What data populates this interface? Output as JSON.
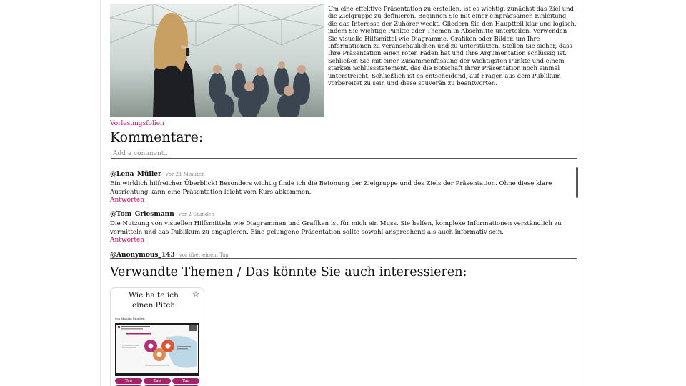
{
  "article": {
    "description": "Um eine effektive Präsentation zu erstellen, ist es wichtig, zunächst das Ziel und die Zielgruppe zu definieren. Beginnen Sie mit einer einprägsamen Einleitung, die das Interesse der Zuhörer weckt. Gliedern Sie den Hauptteil klar und logisch, indem Sie wichtige Punkte oder Themen in Abschnitte unterteilen. Verwenden Sie visuelle Hilfsmittel wie Diagramme, Grafiken oder Bilder, um Ihre Informationen zu veranschaulichen und zu unterstützen. Stellen Sie sicher, dass Ihre Präsentation einen roten Faden hat und Ihre Argumentation schlüssig ist. Schließen Sie mit einer Zusammenfassung der wichtigsten Punkte und einem starken Schlussstatement, das die Botschaft Ihrer Präsentation noch einmal unterstreicht. Schließlich ist es entscheidend, auf Fragen aus dem Publikum vorbereitet zu sein und diese souverän zu beantworten.",
    "image_caption": "Vorlesungsfolien"
  },
  "comments": {
    "title": "Kommentare:",
    "input_placeholder": "Add a comment...",
    "items": [
      {
        "user": "@Lena_Müller",
        "time": "vor 21 Minuten",
        "text": "Ein wirklich hilfreicher Überblick! Besonders wichtig finde ich die Betonung der Zielgruppe und des Ziels der Präsentation. Ohne diese klare Ausrichtung kann eine Präsentation leicht vom Kurs abkommen.",
        "reply": "Antworten"
      },
      {
        "user": "@Tom_Griesmann",
        "time": "vor 2 Stunden",
        "text": "Die Nutzung von visuellen Hilfsmitteln wie Diagrammen und Grafiken ist für mich ein Muss. Sie helfen, komplexe Informationen verständlich zu vermitteln und das Publikum zu engagieren. Eine gelungene Präsentation sollte sowohl ansprechend als auch informativ sein.",
        "reply": "Antworten"
      },
      {
        "user": "@Anonymous_143",
        "time": "vor über einem Tag"
      }
    ]
  },
  "related": {
    "title": "Verwandte Themen / Das könnte Sie auch interessieren:",
    "cards": [
      {
        "title": "Wie halte ich einen Pitch",
        "star_icon": "star-outline-icon",
        "author": "von Monika Engelen",
        "tags": [
          "Tag",
          "Tag",
          "Tag"
        ]
      }
    ]
  },
  "colors": {
    "accent": "#c2186b",
    "tag": "#a4246c"
  }
}
